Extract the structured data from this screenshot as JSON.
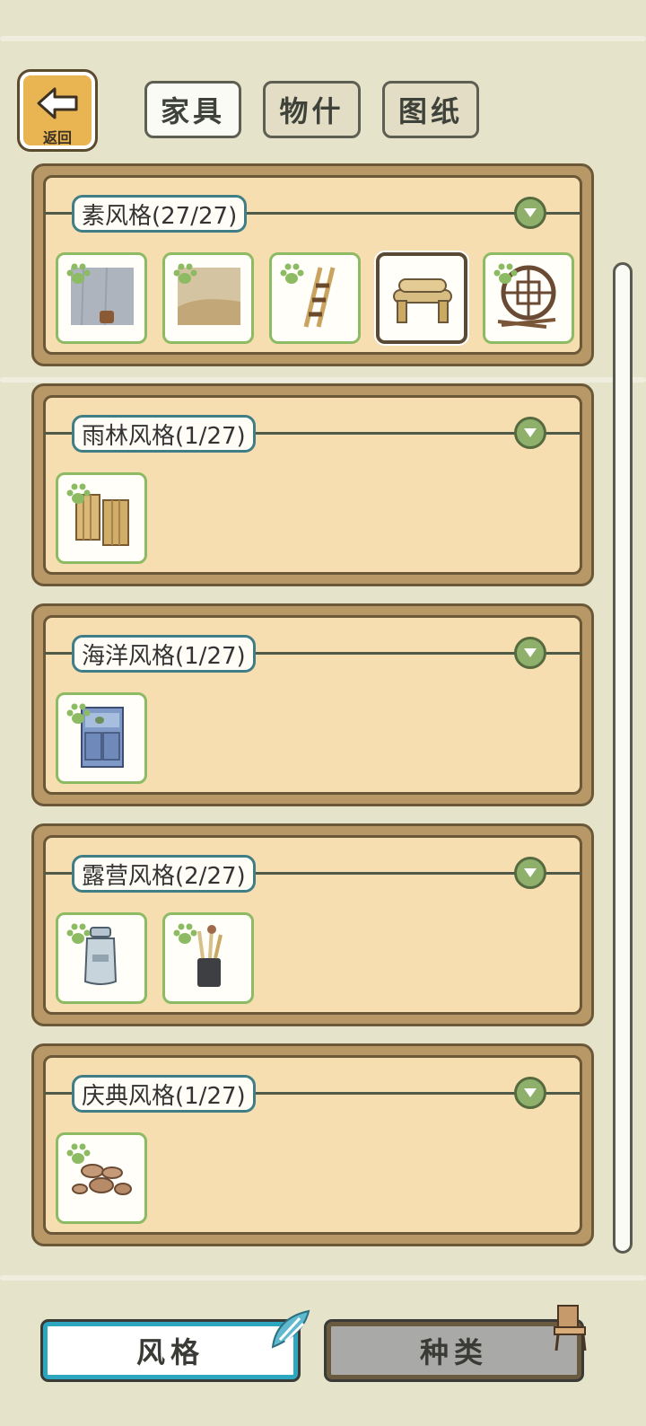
{
  "header": {
    "back_label": "返回",
    "tabs": [
      {
        "label": "家具"
      },
      {
        "label": "物什"
      },
      {
        "label": "图纸"
      }
    ]
  },
  "sections": [
    {
      "title": "素风格(27/27)"
    },
    {
      "title": "雨林风格(1/27)"
    },
    {
      "title": "海洋风格(1/27)"
    },
    {
      "title": "露营风格(2/27)"
    },
    {
      "title": "庆典风格(1/27)"
    }
  ],
  "footer": {
    "style_label": "风格",
    "type_label": "种类"
  },
  "colors": {
    "background": "#e6e3cb",
    "panel_frame": "#b79866",
    "panel_inner": "#f6deb0",
    "item_border": "#8cbb63",
    "title_border": "#3f7e86",
    "active_button_border": "#2da7bf",
    "toggle_green": "#8fb06a"
  }
}
